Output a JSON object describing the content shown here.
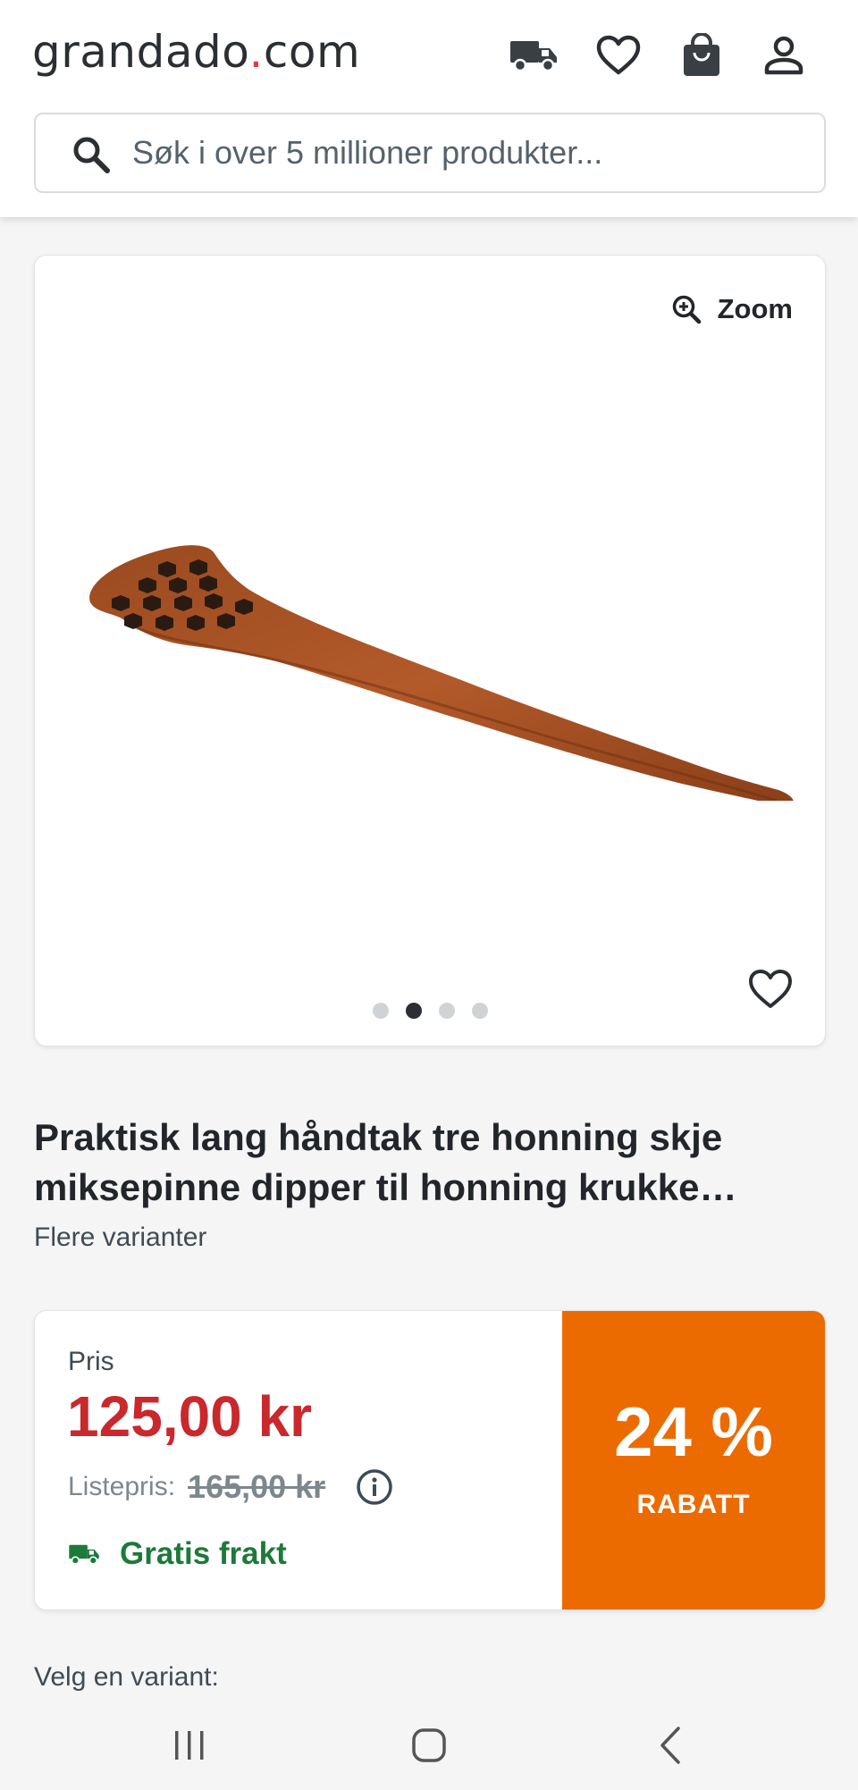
{
  "header": {
    "logo_main": "grandado",
    "logo_dot": ".",
    "logo_tld": "com",
    "icons": [
      "delivery-truck-icon",
      "heart-icon",
      "shopping-bag-icon",
      "account-icon"
    ]
  },
  "search": {
    "placeholder": "Søk i over 5 millioner produkter..."
  },
  "gallery": {
    "zoom_label": "Zoom",
    "image_count": 4,
    "active_index": 1
  },
  "product": {
    "title": "Praktisk lang håndtak tre honning skje miksepinne dipper til honning krukke…",
    "variants_link": "Flere varianter"
  },
  "pricing": {
    "price_label": "Pris",
    "price": "125,00 kr",
    "list_label": "Listepris:",
    "list_price": "165,00 kr",
    "shipping": "Gratis frakt",
    "discount_percent": "24 %",
    "discount_label": "RABATT"
  },
  "variant_section": {
    "label": "Velg en variant:"
  },
  "colors": {
    "price_red": "#c9282d",
    "discount_orange": "#ec6b00",
    "shipping_green": "#1d7a3a",
    "logo_dot_red": "#e43a40"
  }
}
